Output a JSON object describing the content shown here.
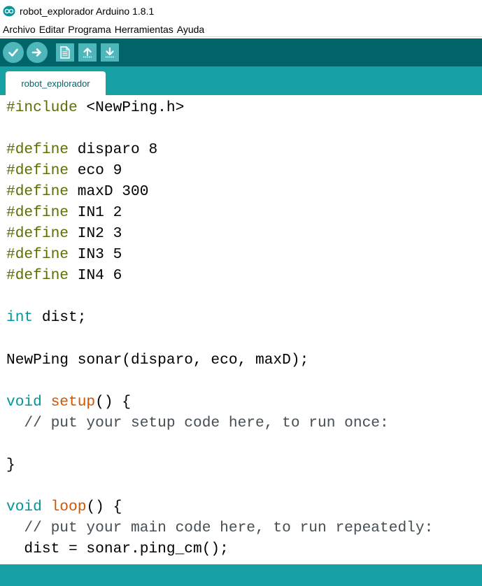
{
  "window": {
    "title": "robot_explorador Arduino 1.8.1",
    "icon": "arduino-logo-icon"
  },
  "menu": {
    "items": [
      "Archivo",
      "Editar",
      "Programa",
      "Herramientas",
      "Ayuda"
    ]
  },
  "toolbar": {
    "buttons": [
      "verify-icon",
      "upload-icon",
      "new-icon",
      "open-icon",
      "save-icon"
    ]
  },
  "tabs": [
    {
      "label": "robot_explorador",
      "active": true
    }
  ],
  "colors": {
    "toolbar": "#006468",
    "tabbar": "#17a1a5",
    "button": "#4db7bb",
    "preprocessor": "#5e6d03",
    "type_keyword": "#00979c",
    "function": "#d35400",
    "comment": "#434f54"
  },
  "code": {
    "l1": {
      "a": "#include",
      "b": " <NewPing.h>"
    },
    "l3": {
      "a": "#define",
      "b": " disparo 8"
    },
    "l4": {
      "a": "#define",
      "b": " eco 9"
    },
    "l5": {
      "a": "#define",
      "b": " maxD 300"
    },
    "l6": {
      "a": "#define",
      "b": " IN1 2"
    },
    "l7": {
      "a": "#define",
      "b": " IN2 3"
    },
    "l8": {
      "a": "#define",
      "b": " IN3 5"
    },
    "l9": {
      "a": "#define",
      "b": " IN4 6"
    },
    "l11": {
      "a": "int",
      "b": " dist;"
    },
    "l13": {
      "text": "NewPing sonar(disparo, eco, maxD);"
    },
    "l15": {
      "a": "void",
      "b": " ",
      "c": "setup",
      "d": "() {"
    },
    "l16": {
      "text": "  // put your setup code here, to run once:"
    },
    "l18": {
      "text": "}"
    },
    "l20": {
      "a": "void",
      "b": " ",
      "c": "loop",
      "d": "() {"
    },
    "l21": {
      "text": "  // put your main code here, to run repeatedly:"
    },
    "l22": {
      "text": "  dist = sonar.ping_cm();"
    }
  }
}
